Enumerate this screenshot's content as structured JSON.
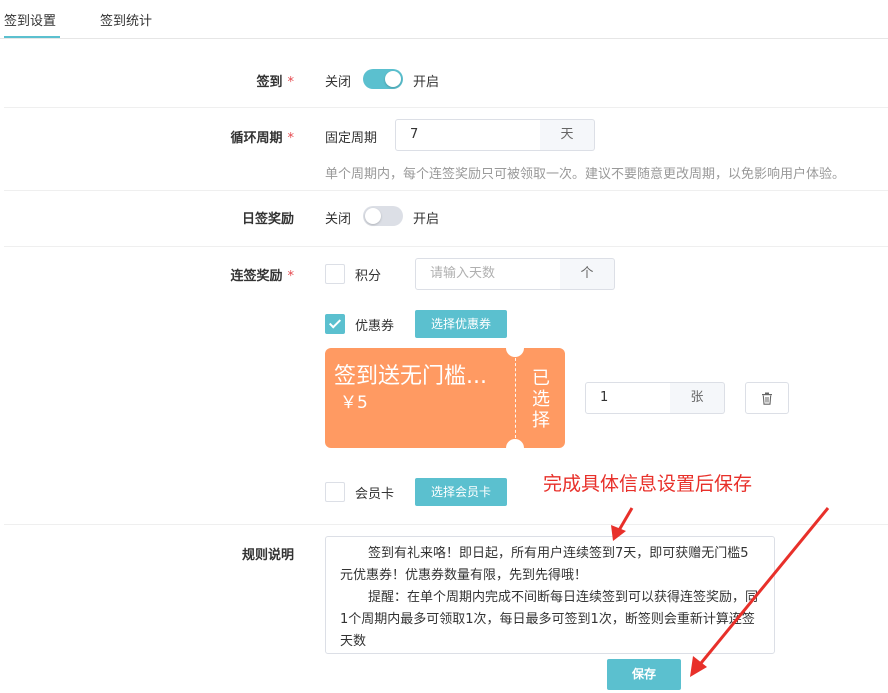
{
  "tabs": [
    "签到设置",
    "签到统计"
  ],
  "form": {
    "signin": {
      "label": "签到",
      "off": "关闭",
      "on": "开启",
      "enabled": true
    },
    "cycle": {
      "label": "循环周期",
      "type": "固定周期",
      "value": "7",
      "unit": "天",
      "hint": "单个周期内，每个连签奖励只可被领取一次。建议不要随意更改周期，以免影响用户体验。"
    },
    "daily": {
      "label": "日签奖励",
      "off": "关闭",
      "on": "开启",
      "enabled": false
    },
    "streak": {
      "label": "连签奖励",
      "points": {
        "label": "积分",
        "checked": false,
        "placeholder": "请输入天数",
        "unit": "个"
      },
      "coupon": {
        "label": "优惠券",
        "checked": true,
        "button": "选择优惠券"
      },
      "coupon_card": {
        "title": "签到送无门槛...",
        "price": "￥5",
        "status": "已选择"
      },
      "coupon_qty": {
        "value": "1",
        "unit": "张"
      },
      "member_card": {
        "label": "会员卡",
        "checked": false,
        "button": "选择会员卡"
      }
    },
    "rules": {
      "label": "规则说明",
      "p1": "签到有礼来咯！即日起，所有用户连续签到7天，即可获赠无门槛5元优惠券！优惠券数量有限，先到先得哦！",
      "p2": "提醒：在单个周期内完成不间断每日连续签到可以获得连签奖励，同1个周期内最多可领取1次，每日最多可签到1次，断签则会重新计算连签天数"
    },
    "save": "保存"
  },
  "annotation": "完成具体信息设置后保存",
  "colors": {
    "accent": "#5bc0cf",
    "coupon": "#ff9a62",
    "required": "#e5484d",
    "annotation": "#e8302a"
  }
}
